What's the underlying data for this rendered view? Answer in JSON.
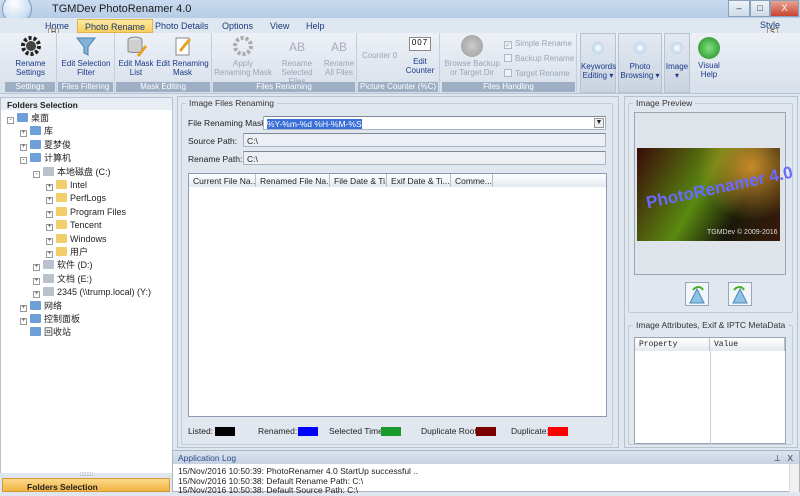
{
  "app": {
    "title": "TGMDev PhotoRenamer 4.0"
  },
  "window": {
    "minimize": "–",
    "maximize": "□",
    "close": "X"
  },
  "tabs": [
    {
      "label": "Home",
      "key": "H"
    },
    {
      "label": "Photo Rename"
    },
    {
      "label": "Photo Details"
    },
    {
      "label": "Options"
    },
    {
      "label": "View"
    },
    {
      "label": "Help"
    }
  ],
  "style": {
    "label": "Style",
    "key": "S"
  },
  "ribbon": {
    "groups": [
      "Settings",
      "Files Filtering",
      "Mask Editing",
      "Files Renaming",
      "Picture Counter (%C)",
      "Files Handling"
    ],
    "buttons": {
      "rename_settings": "Rename Settings",
      "edit_filter": "Edit Selection Filter",
      "edit_mask_list": "Edit Mask List",
      "edit_renaming_mask": "Edit Renaming Mask",
      "apply_mask": "Apply Renaming Mask",
      "rename_selected": "Rename Selected Files",
      "rename_all": "Rename All Files",
      "counter": "Counter 0",
      "counter_digits": "007",
      "edit_counter": "Edit Counter",
      "browse_backup": "Browse Backup or Target Dir",
      "keywords": "Keywords Editing ▾",
      "photo_browsing": "Photo Browsing ▾",
      "image": "Image ▾",
      "visual_help": "Visual Help"
    },
    "checks": [
      {
        "label": "Simple Rename",
        "checked": true
      },
      {
        "label": "Backup Rename",
        "checked": false
      },
      {
        "label": "Target Rename",
        "checked": false
      }
    ]
  },
  "folders": {
    "title": "Folders Selection",
    "bottom_button": "Folders Selection",
    "tree": [
      {
        "label": "桌面",
        "level": 0,
        "exp": "-"
      },
      {
        "label": "库",
        "level": 1,
        "exp": "+"
      },
      {
        "label": "夏梦俊",
        "level": 1,
        "exp": "+"
      },
      {
        "label": "计算机",
        "level": 1,
        "exp": "-"
      },
      {
        "label": "本地磁盘 (C:)",
        "level": 2,
        "exp": "-"
      },
      {
        "label": "Intel",
        "level": 3,
        "exp": "+"
      },
      {
        "label": "PerfLogs",
        "level": 3,
        "exp": "+"
      },
      {
        "label": "Program Files",
        "level": 3,
        "exp": "+"
      },
      {
        "label": "Tencent",
        "level": 3,
        "exp": "+"
      },
      {
        "label": "Windows",
        "level": 3,
        "exp": "+"
      },
      {
        "label": "用户",
        "level": 3,
        "exp": "+"
      },
      {
        "label": "软件 (D:)",
        "level": 2,
        "exp": "+"
      },
      {
        "label": "文档 (E:)",
        "level": 2,
        "exp": "+"
      },
      {
        "label": "2345 (\\\\trump.local) (Y:)",
        "level": 2,
        "exp": "+"
      },
      {
        "label": "网络",
        "level": 1,
        "exp": "+"
      },
      {
        "label": "控制面板",
        "level": 1,
        "exp": "+"
      },
      {
        "label": "回收站",
        "level": 1,
        "exp": ""
      }
    ]
  },
  "renaming": {
    "title": "Image Files Renaming",
    "mask_label": "File Renaming Mask:",
    "mask_value": "%Y-%m-%d %H-%M-%S",
    "source_label": "Source Path:",
    "source_value": "C:\\",
    "rename_label": "Rename Path:",
    "rename_value": "C:\\",
    "columns": [
      "Current File Na...",
      "Renamed File Na...",
      "File Date & Ti...",
      "Exif Date & Ti...",
      "Comme..."
    ],
    "legend": [
      {
        "label": "Listed:",
        "color": "#000000"
      },
      {
        "label": "Renamed:",
        "color": "#0000ff"
      },
      {
        "label": "Selected Time:",
        "color": "#1a9a2a"
      },
      {
        "label": "Duplicate Root:",
        "color": "#7a0000"
      },
      {
        "label": "Duplicate:",
        "color": "#ff0000"
      }
    ]
  },
  "preview": {
    "title": "Image Preview",
    "image_text": "PhotoRenamer 4.0",
    "image_caption": "TGMDev © 2009-2016",
    "meta_title": "Image Attributes, Exif & IPTC MetaData",
    "meta_columns": [
      "Property",
      "Value"
    ]
  },
  "log": {
    "title": "Application Log",
    "pin": "⊥",
    "close": "X",
    "lines": [
      "15/Nov/2016 10:50:39: PhotoRenamer 4.0 StartUp successful ..",
      "15/Nov/2016 10:50:38: Default Rename Path: C:\\",
      "15/Nov/2016 10:50:38: Default Source Path: C:\\"
    ]
  }
}
